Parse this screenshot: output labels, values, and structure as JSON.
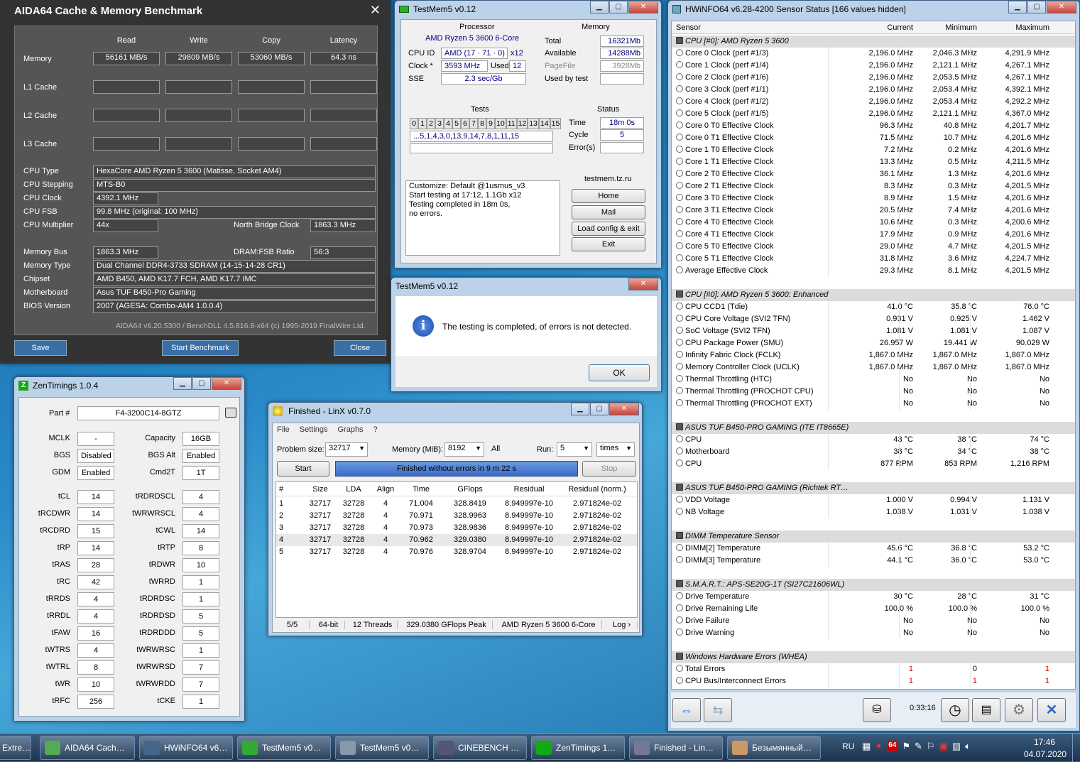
{
  "aida": {
    "title": "AIDA64 Cache & Memory Benchmark",
    "cols": [
      "Read",
      "Write",
      "Copy",
      "Latency"
    ],
    "rows": [
      {
        "label": "Memory",
        "vals": [
          "56161 MB/s",
          "29809 MB/s",
          "53060 MB/s",
          "64.3 ns"
        ]
      },
      {
        "label": "L1 Cache",
        "vals": [
          "",
          "",
          "",
          ""
        ]
      },
      {
        "label": "L2 Cache",
        "vals": [
          "",
          "",
          "",
          ""
        ]
      },
      {
        "label": "L3 Cache",
        "vals": [
          "",
          "",
          "",
          ""
        ]
      }
    ],
    "cpu_type_l": "CPU Type",
    "cpu_type": "HexaCore AMD Ryzen 5 3600  (Matisse, Socket AM4)",
    "cpu_step_l": "CPU Stepping",
    "cpu_step": "MTS-B0",
    "cpu_clock_l": "CPU Clock",
    "cpu_clock": "4392.1 MHz",
    "cpu_fsb_l": "CPU FSB",
    "cpu_fsb": "99.8 MHz  (original: 100 MHz)",
    "cpu_mult_l": "CPU Multiplier",
    "cpu_mult": "44x",
    "nb_l": "North Bridge Clock",
    "nb": "1863.3 MHz",
    "mem_bus_l": "Memory Bus",
    "mem_bus": "1863.3 MHz",
    "ratio_l": "DRAM:FSB Ratio",
    "ratio": "56:3",
    "mem_type_l": "Memory Type",
    "mem_type": "Dual Channel DDR4-3733 SDRAM  (14-15-14-28 CR1)",
    "chipset_l": "Chipset",
    "chipset": "AMD B450, AMD K17.7 FCH, AMD K17.7 IMC",
    "mobo_l": "Motherboard",
    "mobo": "Asus TUF B450-Pro Gaming",
    "bios_l": "BIOS Version",
    "bios": "2007  (AGESA: Combo-AM4 1.0.0.4)",
    "footer": "AIDA64 v6.20.5300 / BenchDLL 4.5.816.8-x64  (c) 1995-2019 FinalWire Ltd.",
    "save": "Save",
    "start": "Start Benchmark",
    "close": "Close"
  },
  "tm": {
    "title": "TestMem5 v0.12",
    "proc_h": "Processor",
    "proc": "AMD Ryzen 5 3600 6-Core",
    "cpuid_l": "CPU ID",
    "cpuid": "AMD  (17 · 71 · 0)",
    "cpuid_x": "x12",
    "clock_l": "Clock *",
    "clock": "3593 MHz",
    "used_l": "Used",
    "used": "12",
    "sse_l": "SSE",
    "sse": "2.3 sec/Gb",
    "mem_h": "Memory",
    "total_l": "Total",
    "total": "16321Mb",
    "avail_l": "Available",
    "avail": "14288Mb",
    "page_l": "PageFile",
    "page": "3928Mb",
    "ubt_l": "Used by test",
    "tests_h": "Tests",
    "tests": [
      "0",
      "1",
      "2",
      "3",
      "4",
      "5",
      "6",
      "7",
      "8",
      "9",
      "10",
      "11",
      "12",
      "13",
      "14",
      "15"
    ],
    "seq": "...5,1,4,3,0,13,9,14,7,8,1,11,15",
    "status_h": "Status",
    "time_l": "Time",
    "time": "18m 0s",
    "cycle_l": "Cycle",
    "cycle": "5",
    "err_l": "Error(s)",
    "log": [
      "Customize: Default @1usmus_v3",
      "Start testing at 17:12, 1.1Gb x12",
      "Testing completed in 18m 0s,",
      "no errors."
    ],
    "site": "testmem.tz.ru",
    "home": "Home",
    "mail": "Mail",
    "load": "Load config & exit",
    "exit": "Exit"
  },
  "dlg": {
    "title": "TestMem5 v0.12",
    "msg": "The testing is completed, of errors is not detected.",
    "ok": "OK"
  },
  "zen": {
    "title": "ZenTimings 1.0.4",
    "part_l": "Part #",
    "part": "F4-3200C14-8GTZ",
    "top": [
      [
        "MCLK",
        "-",
        "Capacity",
        "16GB"
      ],
      [
        "BGS",
        "Disabled",
        "BGS Alt",
        "Enabled"
      ],
      [
        "GDM",
        "Enabled",
        "Cmd2T",
        "1T"
      ]
    ],
    "timings": [
      [
        "tCL",
        "14",
        "tRDRDSCL",
        "4"
      ],
      [
        "tRCDWR",
        "14",
        "tWRWRSCL",
        "4"
      ],
      [
        "tRCDRD",
        "15",
        "tCWL",
        "14"
      ],
      [
        "tRP",
        "14",
        "tRTP",
        "8"
      ],
      [
        "tRAS",
        "28",
        "tRDWR",
        "10"
      ],
      [
        "tRC",
        "42",
        "tWRRD",
        "1"
      ],
      [
        "tRRDS",
        "4",
        "tRDRDSC",
        "1"
      ],
      [
        "tRRDL",
        "4",
        "tRDRDSD",
        "5"
      ],
      [
        "tFAW",
        "16",
        "tRDRDDD",
        "5"
      ],
      [
        "tWTRS",
        "4",
        "tWRWRSC",
        "1"
      ],
      [
        "tWTRL",
        "8",
        "tWRWRSD",
        "7"
      ],
      [
        "tWR",
        "10",
        "tWRWRDD",
        "7"
      ],
      [
        "tRFC",
        "256",
        "tCKE",
        "1"
      ]
    ]
  },
  "linx": {
    "title": "Finished - LinX v0.7.0",
    "menu": [
      "File",
      "Settings",
      "Graphs",
      "?"
    ],
    "ps_l": "Problem size:",
    "ps": "32717",
    "mem_l": "Memory (MiB):",
    "mem": "8192",
    "all": "All",
    "run_l": "Run:",
    "run": "5",
    "times": "times",
    "start": "Start",
    "status": "Finished without errors in 9 m 22 s",
    "stop": "Stop",
    "cols": [
      "#",
      "Size",
      "LDA",
      "Align",
      "Time",
      "GFlops",
      "Residual",
      "Residual (norm.)"
    ],
    "rows": [
      [
        "1",
        "32717",
        "32728",
        "4",
        "71.004",
        "328.8419",
        "8.949997e-10",
        "2.971824e-02"
      ],
      [
        "2",
        "32717",
        "32728",
        "4",
        "70.971",
        "328.9963",
        "8.949997e-10",
        "2.971824e-02"
      ],
      [
        "3",
        "32717",
        "32728",
        "4",
        "70.973",
        "328.9836",
        "8.949997e-10",
        "2.971824e-02"
      ],
      [
        "4",
        "32717",
        "32728",
        "4",
        "70.962",
        "329.0380",
        "8.949997e-10",
        "2.971824e-02"
      ],
      [
        "5",
        "32717",
        "32728",
        "4",
        "70.976",
        "328.9704",
        "8.949997e-10",
        "2.971824e-02"
      ]
    ],
    "sb": [
      "5/5",
      "64-bit",
      "12 Threads",
      "329.0380 GFlops Peak",
      "AMD Ryzen 5 3600 6-Core",
      "Log ›"
    ]
  },
  "hw": {
    "title": "HWiNFO64 v6.28-4200 Sensor Status [166 values hidden]",
    "cols": [
      "Sensor",
      "Current",
      "Minimum",
      "Maximum"
    ],
    "uptime": "0:33:16",
    "rows": [
      {
        "s": 1,
        "n": "CPU [#0]: AMD Ryzen 5 3600"
      },
      {
        "n": "Core 0 Clock (perf #1/3)",
        "c": "2,196.0 MHz",
        "mi": "2,046.3 MHz",
        "ma": "4,291.9 MHz"
      },
      {
        "n": "Core 1 Clock (perf #1/4)",
        "c": "2,196.0 MHz",
        "mi": "2,121.1 MHz",
        "ma": "4,267.1 MHz"
      },
      {
        "n": "Core 2 Clock (perf #1/6)",
        "c": "2,196.0 MHz",
        "mi": "2,053.5 MHz",
        "ma": "4,267.1 MHz"
      },
      {
        "n": "Core 3 Clock (perf #1/1)",
        "c": "2,196.0 MHz",
        "mi": "2,053.4 MHz",
        "ma": "4,392.1 MHz"
      },
      {
        "n": "Core 4 Clock (perf #1/2)",
        "c": "2,196.0 MHz",
        "mi": "2,053.4 MHz",
        "ma": "4,292.2 MHz"
      },
      {
        "n": "Core 5 Clock (perf #1/5)",
        "c": "2,196.0 MHz",
        "mi": "2,121.1 MHz",
        "ma": "4,367.0 MHz"
      },
      {
        "n": "Core 0 T0 Effective Clock",
        "c": "96.3 MHz",
        "mi": "40.8 MHz",
        "ma": "4,201.7 MHz"
      },
      {
        "n": "Core 0 T1 Effective Clock",
        "c": "71.5 MHz",
        "mi": "10.7 MHz",
        "ma": "4,201.6 MHz"
      },
      {
        "n": "Core 1 T0 Effective Clock",
        "c": "7.2 MHz",
        "mi": "0.2 MHz",
        "ma": "4,201.6 MHz"
      },
      {
        "n": "Core 1 T1 Effective Clock",
        "c": "13.3 MHz",
        "mi": "0.5 MHz",
        "ma": "4,211.5 MHz"
      },
      {
        "n": "Core 2 T0 Effective Clock",
        "c": "36.1 MHz",
        "mi": "1.3 MHz",
        "ma": "4,201.6 MHz"
      },
      {
        "n": "Core 2 T1 Effective Clock",
        "c": "8.3 MHz",
        "mi": "0.3 MHz",
        "ma": "4,201.5 MHz"
      },
      {
        "n": "Core 3 T0 Effective Clock",
        "c": "8.9 MHz",
        "mi": "1.5 MHz",
        "ma": "4,201.6 MHz"
      },
      {
        "n": "Core 3 T1 Effective Clock",
        "c": "20.5 MHz",
        "mi": "7.4 MHz",
        "ma": "4,201.6 MHz"
      },
      {
        "n": "Core 4 T0 Effective Clock",
        "c": "10.6 MHz",
        "mi": "0.3 MHz",
        "ma": "4,200.6 MHz"
      },
      {
        "n": "Core 4 T1 Effective Clock",
        "c": "17.9 MHz",
        "mi": "0.9 MHz",
        "ma": "4,201.6 MHz"
      },
      {
        "n": "Core 5 T0 Effective Clock",
        "c": "29.0 MHz",
        "mi": "4.7 MHz",
        "ma": "4,201.5 MHz"
      },
      {
        "n": "Core 5 T1 Effective Clock",
        "c": "31.8 MHz",
        "mi": "3.6 MHz",
        "ma": "4,224.7 MHz"
      },
      {
        "n": "Average Effective Clock",
        "c": "29.3 MHz",
        "mi": "8.1 MHz",
        "ma": "4,201.5 MHz"
      },
      {
        "g": 1
      },
      {
        "s": 1,
        "n": "CPU [#0]: AMD Ryzen 5 3600: Enhanced"
      },
      {
        "n": "CPU CCD1 (Tdie)",
        "c": "41.0 °C",
        "mi": "35.8 °C",
        "ma": "76.0 °C"
      },
      {
        "n": "CPU Core Voltage (SVI2 TFN)",
        "c": "0.931 V",
        "mi": "0.925 V",
        "ma": "1.462 V"
      },
      {
        "n": "SoC Voltage (SVI2 TFN)",
        "c": "1.081 V",
        "mi": "1.081 V",
        "ma": "1.087 V"
      },
      {
        "n": "CPU Package Power (SMU)",
        "c": "26.957 W",
        "mi": "19.441 W",
        "ma": "90.029 W"
      },
      {
        "n": "Infinity Fabric Clock (FCLK)",
        "c": "1,867.0 MHz",
        "mi": "1,867.0 MHz",
        "ma": "1,867.0 MHz"
      },
      {
        "n": "Memory Controller Clock (UCLK)",
        "c": "1,867.0 MHz",
        "mi": "1,867.0 MHz",
        "ma": "1,867.0 MHz"
      },
      {
        "n": "Thermal Throttling (HTC)",
        "c": "No",
        "mi": "No",
        "ma": "No"
      },
      {
        "n": "Thermal Throttling (PROCHOT CPU)",
        "c": "No",
        "mi": "No",
        "ma": "No"
      },
      {
        "n": "Thermal Throttling (PROCHOT EXT)",
        "c": "No",
        "mi": "No",
        "ma": "No"
      },
      {
        "g": 1
      },
      {
        "s": 1,
        "n": "ASUS TUF B450-PRO GAMING (ITE IT8665E)"
      },
      {
        "n": "CPU",
        "c": "43 °C",
        "mi": "38 °C",
        "ma": "74 °C"
      },
      {
        "n": "Motherboard",
        "c": "38 °C",
        "mi": "34 °C",
        "ma": "38 °C"
      },
      {
        "n": "CPU",
        "c": "877 RPM",
        "mi": "853 RPM",
        "ma": "1,216 RPM"
      },
      {
        "g": 1
      },
      {
        "s": 1,
        "n": "ASUS TUF B450-PRO GAMING (Richtek RT…"
      },
      {
        "n": "VDD Voltage",
        "c": "1.000 V",
        "mi": "0.994 V",
        "ma": "1.131 V"
      },
      {
        "n": "NB Voltage",
        "c": "1.038 V",
        "mi": "1.031 V",
        "ma": "1.038 V"
      },
      {
        "g": 1
      },
      {
        "s": 1,
        "n": "DIMM Temperature Sensor"
      },
      {
        "n": "DIMM[2] Temperature",
        "c": "45.6 °C",
        "mi": "36.8 °C",
        "ma": "53.2 °C"
      },
      {
        "n": "DIMM[3] Temperature",
        "c": "44.1 °C",
        "mi": "36.0 °C",
        "ma": "53.0 °C"
      },
      {
        "g": 1
      },
      {
        "s": 1,
        "n": "S.M.A.R.T.: APS-SE20G-1T (SI27C21606WL)"
      },
      {
        "n": "Drive Temperature",
        "c": "30 °C",
        "mi": "28 °C",
        "ma": "31 °C"
      },
      {
        "n": "Drive Remaining Life",
        "c": "100.0 %",
        "mi": "100.0 %",
        "ma": "100.0 %"
      },
      {
        "n": "Drive Failure",
        "c": "No",
        "mi": "No",
        "ma": "No"
      },
      {
        "n": "Drive Warning",
        "c": "No",
        "mi": "No",
        "ma": "No"
      },
      {
        "g": 1
      },
      {
        "s": 1,
        "n": "Windows Hardware Errors (WHEA)"
      },
      {
        "n": "Total Errors",
        "c": "1",
        "mi": "0",
        "ma": "1",
        "red": 1
      },
      {
        "n": "CPU Bus/Interconnect Errors",
        "c": "1",
        "mi": "1",
        "ma": "1",
        "red": 1
      }
    ]
  },
  "taskbar": {
    "items": [
      "Extre…",
      "AIDA64 Cach…",
      "HWiNFO64 v6…",
      "TestMem5 v0…",
      "TestMem5 v0…",
      "CINEBENCH …",
      "ZenTimings 1…",
      "Finished - Lin…",
      "Безымянный…"
    ],
    "lang": "RU",
    "time": "17:46",
    "date": "04.07.2020",
    "badge": "64"
  },
  "colors": {
    "aida_bg": "#333333",
    "aida_btn": "#3a6ea5",
    "status_bar": "#3a6bc9",
    "error_red": "#d00000"
  }
}
